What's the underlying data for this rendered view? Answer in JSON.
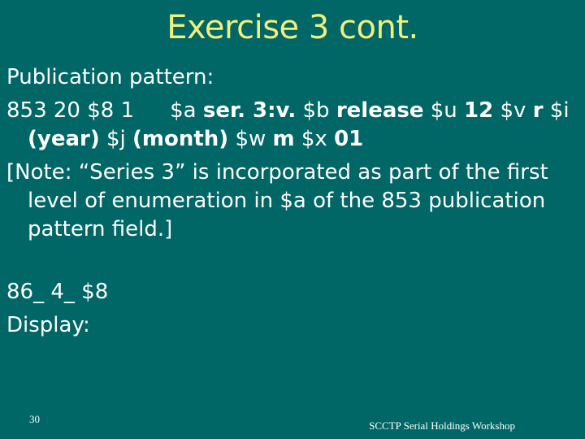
{
  "slide": {
    "title": "Exercise 3 cont.",
    "pub_pattern_label": "Publication pattern:",
    "field853": {
      "t1": "853 20 $8 1",
      "t2": "$a ",
      "b1": "ser. 3:v.",
      "t3": " $b ",
      "b2": "release",
      "t4": " $u ",
      "b3": "12",
      "t5": " $v ",
      "b4": "r",
      "t6": " $i ",
      "b5": "(year)",
      "t7": " $j ",
      "b6": "(month)",
      "t8": " $w ",
      "b7": "m",
      "t9": " $x ",
      "b8": "01"
    },
    "note": "[Note: “Series 3” is incorporated as part of the first level of enumeration in $a of the 853 publication pattern field.]",
    "field86x": "86_ 4_ $8",
    "display_label": "Display:",
    "page_number": "30",
    "footer": "SCCTP Serial Holdings Workshop"
  }
}
